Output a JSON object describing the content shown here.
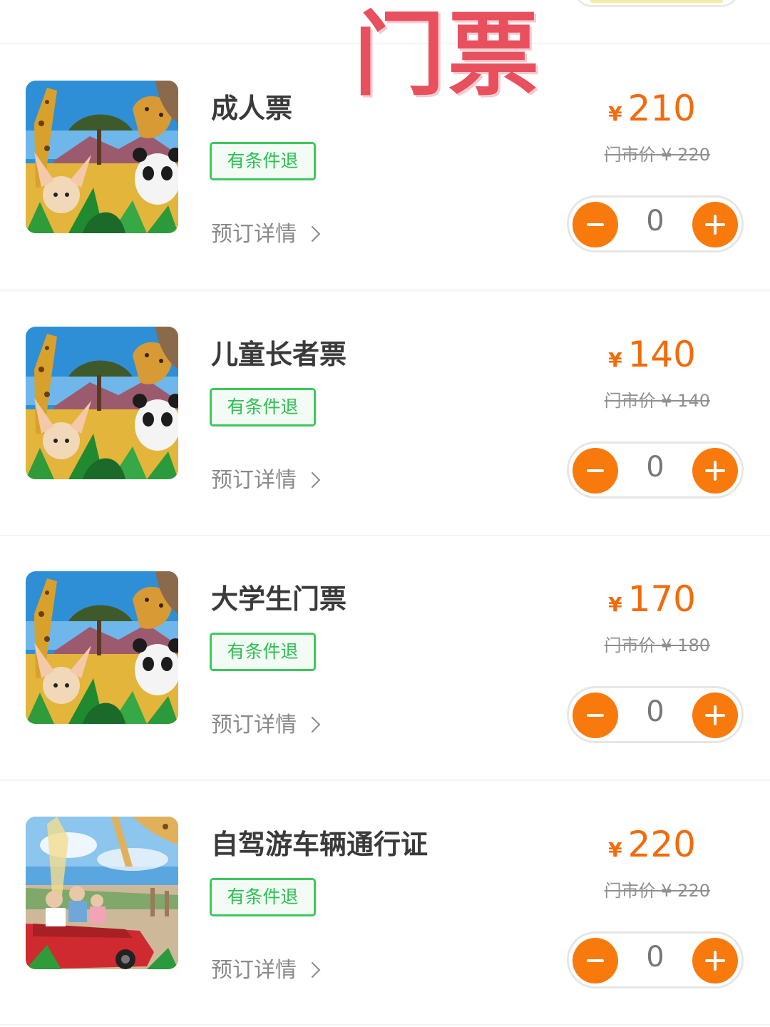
{
  "overlay_title": "门票",
  "tickets": [
    {
      "name": "成人票",
      "refund_label": "有条件退",
      "details_label": "预订详情",
      "currency": "¥",
      "price": "210",
      "market_price": "门市价 ¥ 220",
      "quantity": "0",
      "thumb": "safari-animals-image"
    },
    {
      "name": "儿童长者票",
      "refund_label": "有条件退",
      "details_label": "预订详情",
      "currency": "¥",
      "price": "140",
      "market_price": "门市价 ¥ 140",
      "quantity": "0",
      "thumb": "safari-animals-image"
    },
    {
      "name": "大学生门票",
      "refund_label": "有条件退",
      "details_label": "预订详情",
      "currency": "¥",
      "price": "170",
      "market_price": "门市价 ¥ 180",
      "quantity": "0",
      "thumb": "safari-animals-image"
    },
    {
      "name": "自驾游车辆通行证",
      "refund_label": "有条件退",
      "details_label": "预订详情",
      "currency": "¥",
      "price": "220",
      "market_price": "门市价 ¥ 220",
      "quantity": "0",
      "thumb": "self-drive-car-image"
    }
  ],
  "colors": {
    "price_orange": "#f26b0a",
    "stepper_orange": "#f97a0c",
    "refund_green": "#3ec85c",
    "overlay_red": "#e8505e"
  }
}
